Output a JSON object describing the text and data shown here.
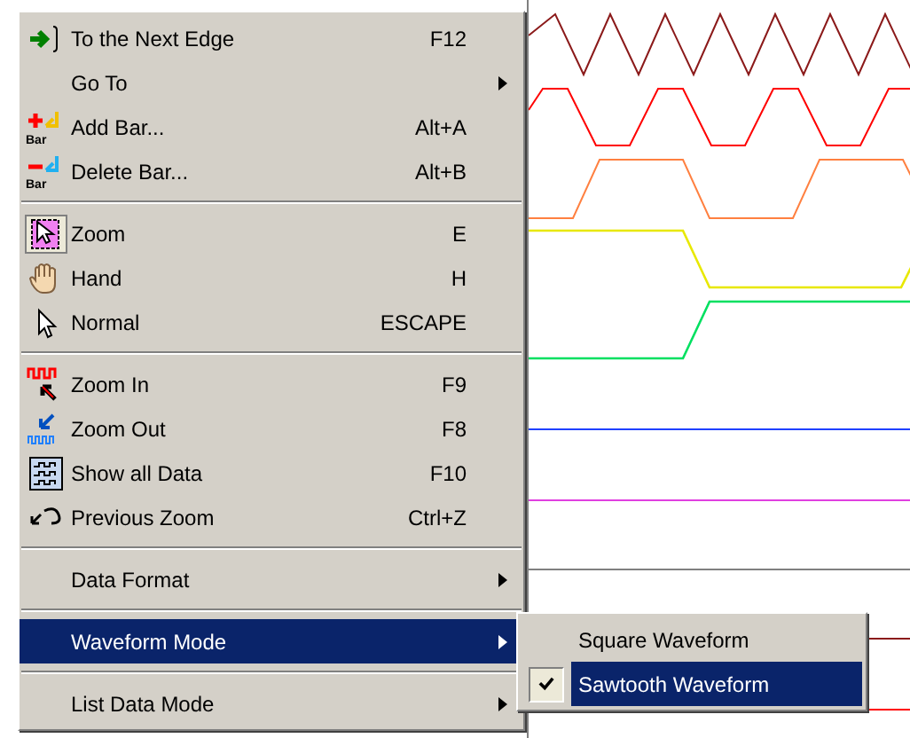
{
  "menu": {
    "items": [
      {
        "kind": "item",
        "label": "To the Next Edge",
        "shortcut": "F12",
        "has_submenu": false,
        "selected": false
      },
      {
        "kind": "item",
        "label": "Go To",
        "has_submenu": true,
        "selected": false
      },
      {
        "kind": "item",
        "label": "Add Bar...",
        "shortcut": "Alt+A",
        "icon_label": "Bar",
        "has_submenu": false,
        "selected": false
      },
      {
        "kind": "item",
        "label": "Delete Bar...",
        "shortcut": "Alt+B",
        "icon_label": "Bar",
        "has_submenu": false,
        "selected": false
      },
      {
        "kind": "separator"
      },
      {
        "kind": "item",
        "label": "Zoom",
        "shortcut": "E",
        "has_submenu": false,
        "selected": false,
        "checked": true
      },
      {
        "kind": "item",
        "label": "Hand",
        "shortcut": "H",
        "has_submenu": false,
        "selected": false
      },
      {
        "kind": "item",
        "label": "Normal",
        "shortcut": "ESCAPE",
        "has_submenu": false,
        "selected": false
      },
      {
        "kind": "separator"
      },
      {
        "kind": "item",
        "label": "Zoom In",
        "shortcut": "F9",
        "has_submenu": false,
        "selected": false
      },
      {
        "kind": "item",
        "label": "Zoom Out",
        "shortcut": "F8",
        "has_submenu": false,
        "selected": false
      },
      {
        "kind": "item",
        "label": "Show all Data",
        "shortcut": "F10",
        "has_submenu": false,
        "selected": false
      },
      {
        "kind": "item",
        "label": "Previous Zoom",
        "shortcut": "Ctrl+Z",
        "has_submenu": false,
        "selected": false
      },
      {
        "kind": "separator"
      },
      {
        "kind": "item",
        "label": "Data Format",
        "has_submenu": true,
        "selected": false
      },
      {
        "kind": "separator"
      },
      {
        "kind": "item",
        "label": "Waveform Mode",
        "has_submenu": true,
        "selected": true
      },
      {
        "kind": "separator"
      },
      {
        "kind": "item",
        "label": "List Data Mode",
        "has_submenu": true,
        "selected": false
      }
    ]
  },
  "submenu": {
    "items": [
      {
        "label": "Square Waveform",
        "checked": false,
        "selected": false
      },
      {
        "label": "Sawtooth Waveform",
        "checked": true,
        "selected": true
      }
    ]
  }
}
